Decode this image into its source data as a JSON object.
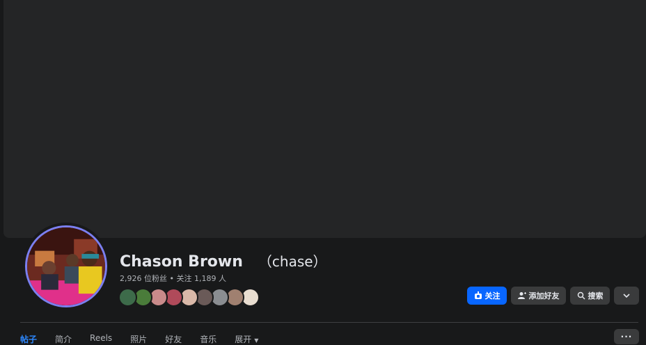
{
  "profile": {
    "name": "Chason Brown",
    "alternate_name": "（chase）",
    "stats": "2,926 位粉丝 • 关注 1,189 人"
  },
  "friends_preview": [
    {
      "color": "#3d6b4a"
    },
    {
      "color": "#4a7c3a"
    },
    {
      "color": "#c98a8a"
    },
    {
      "color": "#b04a5a"
    },
    {
      "color": "#d9b8a8"
    },
    {
      "color": "#6a5a58"
    },
    {
      "color": "#8a8d91"
    },
    {
      "color": "#a08070"
    },
    {
      "color": "#e8ddd0"
    }
  ],
  "actions": {
    "follow_label": "关注",
    "add_friend_label": "添加好友",
    "search_label": "搜索"
  },
  "tabs": [
    {
      "label": "帖子",
      "active": true
    },
    {
      "label": "简介",
      "active": false
    },
    {
      "label": "Reels",
      "active": false
    },
    {
      "label": "照片",
      "active": false
    },
    {
      "label": "好友",
      "active": false
    },
    {
      "label": "音乐",
      "active": false
    },
    {
      "label": "展开",
      "active": false
    }
  ],
  "more_label": "···",
  "colors": {
    "accent": "#0866ff",
    "active_tab": "#2d88ff",
    "background": "#18191a",
    "surface": "#242526",
    "button": "#3a3b3c"
  }
}
